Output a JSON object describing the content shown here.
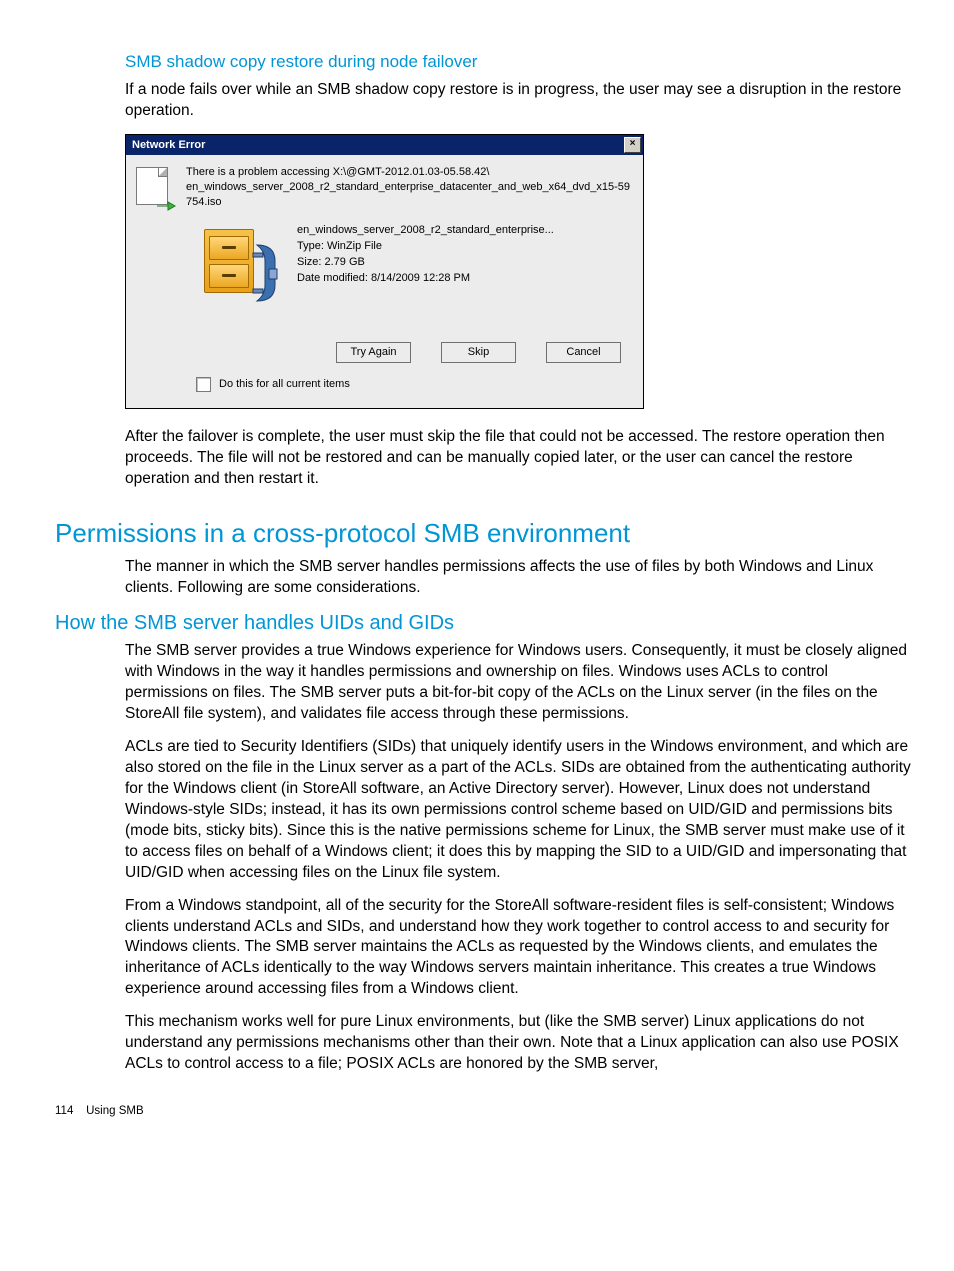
{
  "section": {
    "h3": "SMB shadow copy restore during node failover",
    "p1": "If a node fails over while an SMB shadow copy restore is in progress, the user may see a disruption in the restore operation.",
    "p2": "After the failover is complete, the user must skip the file that could not be accessed. The restore operation then proceeds. The file will not be restored and can be manually copied later, or the user can cancel the restore operation and then restart it."
  },
  "dialog": {
    "title": "Network Error",
    "close": "×",
    "problem_line1": "There is a problem accessing X:\\@GMT-2012.01.03-05.58.42\\",
    "problem_line2": "en_windows_server_2008_r2_standard_enterprise_datacenter_and_web_x64_dvd_x15-59754.iso",
    "file_name": "en_windows_server_2008_r2_standard_enterprise...",
    "file_type": "Type: WinZip File",
    "file_size": "Size: 2.79 GB",
    "file_date": "Date modified: 8/14/2009 12:28 PM",
    "btn_try": "Try Again",
    "btn_skip": "Skip",
    "btn_cancel": "Cancel",
    "checkbox_label": "Do this for all current items"
  },
  "perm": {
    "h1": "Permissions in a cross-protocol SMB environment",
    "p1": "The manner in which the SMB server handles permissions affects the use of files by both Windows and Linux clients. Following are some considerations.",
    "h2": "How the SMB server handles UIDs and GIDs",
    "p2": "The SMB server provides a true Windows experience for Windows users. Consequently, it must be closely aligned with Windows in the way it handles permissions and ownership on files. Windows uses ACLs to control permissions on files. The SMB server puts a bit-for-bit copy of the ACLs on the Linux server (in the files on the StoreAll file system), and validates file access through these permissions.",
    "p3": "ACLs are tied to Security Identifiers (SIDs) that uniquely identify users in the Windows environment, and which are also stored on the file in the Linux server as a part of the ACLs. SIDs are obtained from the authenticating authority for the Windows client (in StoreAll software, an Active Directory server). However, Linux does not understand Windows-style SIDs; instead, it has its own permissions control scheme based on UID/GID and permissions bits (mode bits, sticky bits). Since this is the native permissions scheme for Linux, the SMB server must make use of it to access files on behalf of a Windows client; it does this by mapping the SID to a UID/GID and impersonating that UID/GID when accessing files on the Linux file system.",
    "p4": "From a Windows standpoint, all of the security for the StoreAll software-resident files is self-consistent; Windows clients understand ACLs and SIDs, and understand how they work together to control access to and security for Windows clients. The SMB server maintains the ACLs as requested by the Windows clients, and emulates the inheritance of ACLs identically to the way Windows servers maintain inheritance. This creates a true Windows experience around accessing files from a Windows client.",
    "p5": "This mechanism works well for pure Linux environments, but (like the SMB server) Linux applications do not understand any permissions mechanisms other than their own. Note that a Linux application can also use POSIX ACLs to control access to a file; POSIX ACLs are honored by the SMB server,"
  },
  "footer": {
    "page": "114",
    "chapter": "Using SMB"
  }
}
